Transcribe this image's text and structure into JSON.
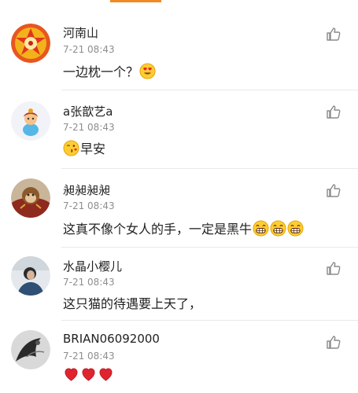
{
  "comments": [
    {
      "username": "河南山",
      "timestamp": "7-21 08:43",
      "text": "一边枕一个？",
      "emojis": [
        "heart-eyes-emoji"
      ],
      "avatar": "mandala-pattern-avatar"
    },
    {
      "username": "a张歆艺a",
      "timestamp": "7-21 08:43",
      "text": "早安",
      "emoji_before": [
        "kiss-face-emoji"
      ],
      "avatar": "cartoon-doll-avatar"
    },
    {
      "username": "昶昶昶昶",
      "timestamp": "7-21 08:43",
      "text": "这真不像个女人的手，一定是黑牛",
      "emojis": [
        "grin-emoji",
        "grin-emoji",
        "grin-emoji"
      ],
      "avatar": "monkey-figure-avatar"
    },
    {
      "username": "水晶小樱儿",
      "timestamp": "7-21 08:43",
      "text": "这只猫的待遇要上天了，",
      "emojis": [],
      "avatar": "person-photo-avatar"
    },
    {
      "username": "BRIAN06092000",
      "timestamp": "7-21 08:43",
      "text": "",
      "emojis": [
        "red-heart-emoji",
        "red-heart-emoji",
        "red-heart-emoji"
      ],
      "avatar": "dark-sketch-avatar"
    }
  ],
  "colors": {
    "accent": "#f08a24",
    "username": "#222222",
    "timestamp": "#8e8e8e",
    "divider": "#e9e9e9",
    "like_icon": "#8a8a8a"
  },
  "icons": {
    "like": "thumbs-up-icon"
  }
}
